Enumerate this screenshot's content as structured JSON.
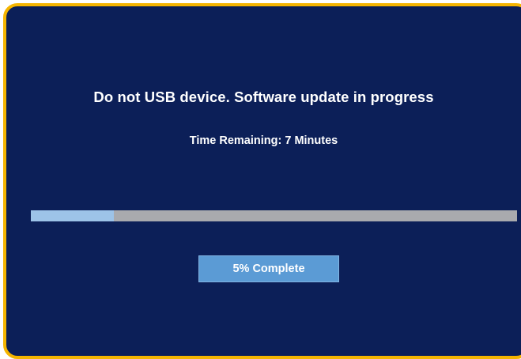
{
  "update_screen": {
    "headline": "Do not USB device. Software update in progress",
    "time_remaining": "Time Remaining: 7 Minutes",
    "progress": {
      "fraction": 0.17
    },
    "complete_label": "5% Complete"
  },
  "colors": {
    "background": "#0c1f58",
    "border": "#f5b500",
    "progress_fill": "#9dc3e8",
    "progress_track": "#a9aaae",
    "badge": "#5b9bd5",
    "text": "#ffffff"
  }
}
